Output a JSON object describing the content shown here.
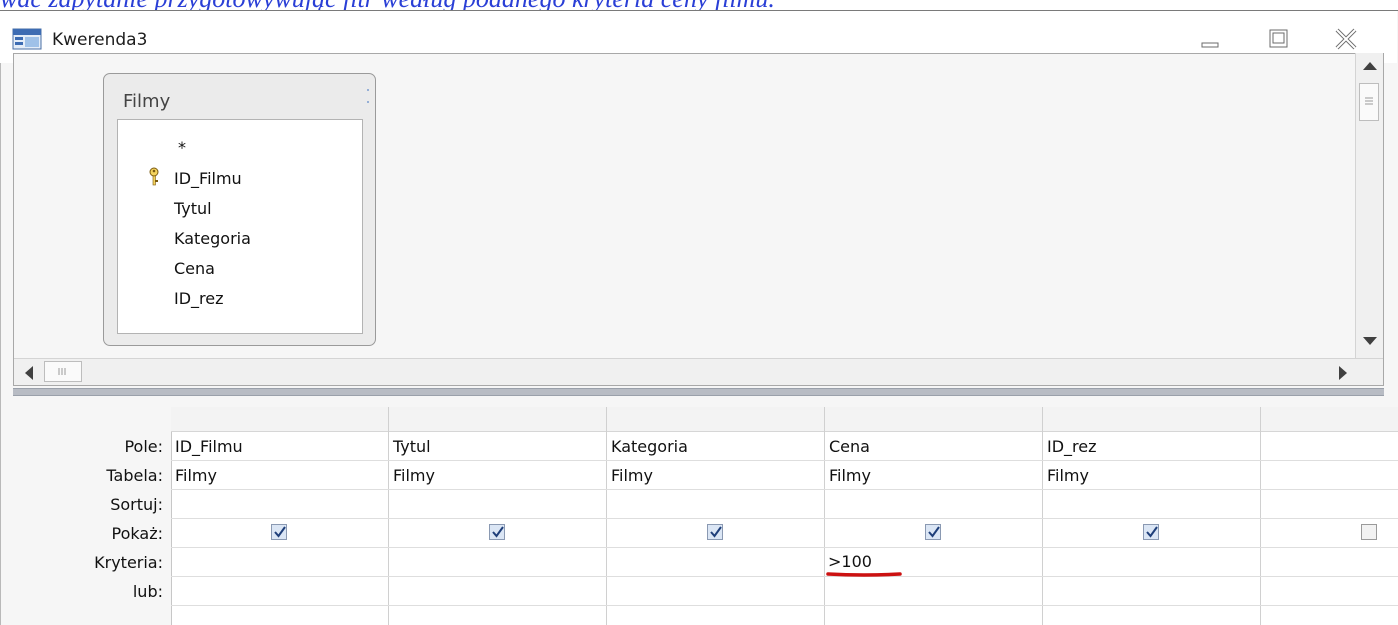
{
  "header_text": "wać zapytanie przygotowywując fitr według podanego kryteria ceny filmu.",
  "window": {
    "title": "Kwerenda3",
    "icons": {
      "app": "query-design-icon",
      "min": "minimize-icon",
      "max": "maximize-icon",
      "close": "close-icon"
    }
  },
  "field_list": {
    "table_name": "Filmy",
    "fields": [
      "*",
      "ID_Filmu",
      "Tytul",
      "Kategoria",
      "Cena",
      "ID_rez"
    ],
    "primary_key": "ID_Filmu"
  },
  "grid": {
    "row_labels": {
      "field": "Pole:",
      "table": "Tabela:",
      "sort": "Sortuj:",
      "show": "Pokaż:",
      "criteria": "Kryteria:",
      "or": "lub:"
    },
    "columns": [
      {
        "field": "ID_Filmu",
        "table": "Filmy",
        "show": true,
        "criteria": ""
      },
      {
        "field": "Tytul",
        "table": "Filmy",
        "show": true,
        "criteria": ""
      },
      {
        "field": "Kategoria",
        "table": "Filmy",
        "show": true,
        "criteria": ""
      },
      {
        "field": "Cena",
        "table": "Filmy",
        "show": true,
        "criteria": ">100"
      },
      {
        "field": "ID_rez",
        "table": "Filmy",
        "show": true,
        "criteria": ""
      },
      {
        "field": "",
        "table": "",
        "show": false,
        "criteria": ""
      }
    ]
  },
  "colors": {
    "link_text": "#2a3fd6",
    "underline_mark": "#cc1111",
    "checkbox_fill": "#dbe6f5"
  }
}
